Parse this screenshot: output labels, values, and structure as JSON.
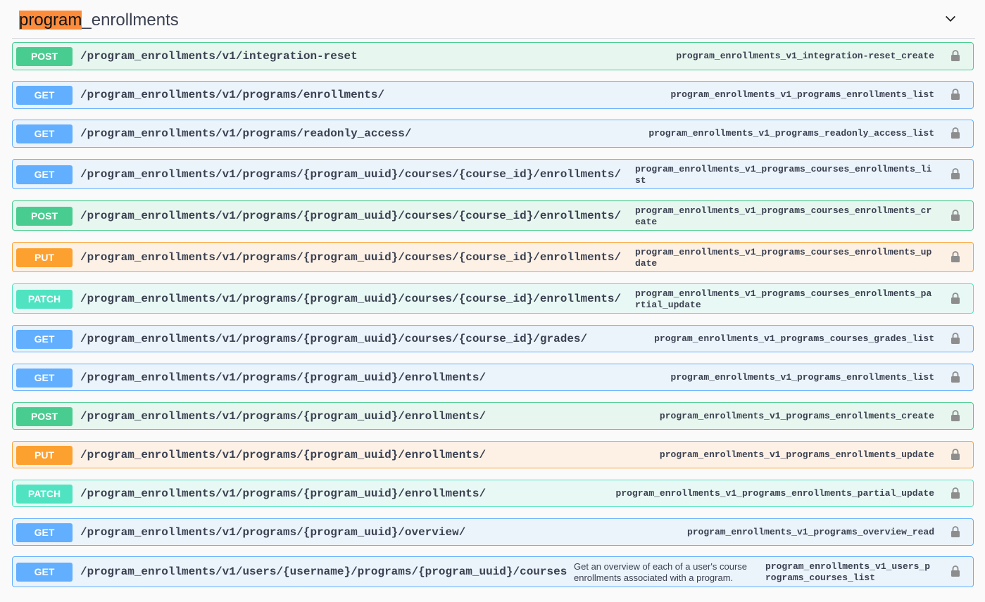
{
  "section": {
    "title_highlight": "program",
    "title_rest": "_enrollments"
  },
  "operations": [
    {
      "method": "POST",
      "path": "/program_enrollments/v1/integration-reset",
      "operation_id": "program_enrollments_v1_integration-reset_create"
    },
    {
      "method": "GET",
      "path": "/program_enrollments/v1/programs/enrollments/",
      "operation_id": "program_enrollments_v1_programs_enrollments_list"
    },
    {
      "method": "GET",
      "path": "/program_enrollments/v1/programs/readonly_access/",
      "operation_id": "program_enrollments_v1_programs_readonly_access_list"
    },
    {
      "method": "GET",
      "path": "/program_enrollments/v1/programs/{program_uuid}/courses/{course_id}/enrollments/",
      "operation_id": "program_enrollments_v1_programs_courses_enrollments_list"
    },
    {
      "method": "POST",
      "path": "/program_enrollments/v1/programs/{program_uuid}/courses/{course_id}/enrollments/",
      "operation_id": "program_enrollments_v1_programs_courses_enrollments_create"
    },
    {
      "method": "PUT",
      "path": "/program_enrollments/v1/programs/{program_uuid}/courses/{course_id}/enrollments/",
      "operation_id": "program_enrollments_v1_programs_courses_enrollments_update"
    },
    {
      "method": "PATCH",
      "path": "/program_enrollments/v1/programs/{program_uuid}/courses/{course_id}/enrollments/",
      "operation_id": "program_enrollments_v1_programs_courses_enrollments_partial_update"
    },
    {
      "method": "GET",
      "path": "/program_enrollments/v1/programs/{program_uuid}/courses/{course_id}/grades/",
      "operation_id": "program_enrollments_v1_programs_courses_grades_list"
    },
    {
      "method": "GET",
      "path": "/program_enrollments/v1/programs/{program_uuid}/enrollments/",
      "operation_id": "program_enrollments_v1_programs_enrollments_list"
    },
    {
      "method": "POST",
      "path": "/program_enrollments/v1/programs/{program_uuid}/enrollments/",
      "operation_id": "program_enrollments_v1_programs_enrollments_create"
    },
    {
      "method": "PUT",
      "path": "/program_enrollments/v1/programs/{program_uuid}/enrollments/",
      "operation_id": "program_enrollments_v1_programs_enrollments_update"
    },
    {
      "method": "PATCH",
      "path": "/program_enrollments/v1/programs/{program_uuid}/enrollments/",
      "operation_id": "program_enrollments_v1_programs_enrollments_partial_update"
    },
    {
      "method": "GET",
      "path": "/program_enrollments/v1/programs/{program_uuid}/overview/",
      "operation_id": "program_enrollments_v1_programs_overview_read"
    },
    {
      "method": "GET",
      "path": "/program_enrollments/v1/users/{username}/programs/{program_uuid}/courses",
      "operation_id": "program_enrollments_v1_users_programs_courses_list",
      "summary": "Get an overview of each of a user's course enrollments associated with a program."
    }
  ],
  "colors": {
    "get": "#61affe",
    "post": "#49cc90",
    "put": "#fca130",
    "patch": "#50e3c2",
    "highlight": "#fc8c3c"
  },
  "icons": {
    "collapse": "chevron-down-icon",
    "auth": "lock-icon"
  }
}
